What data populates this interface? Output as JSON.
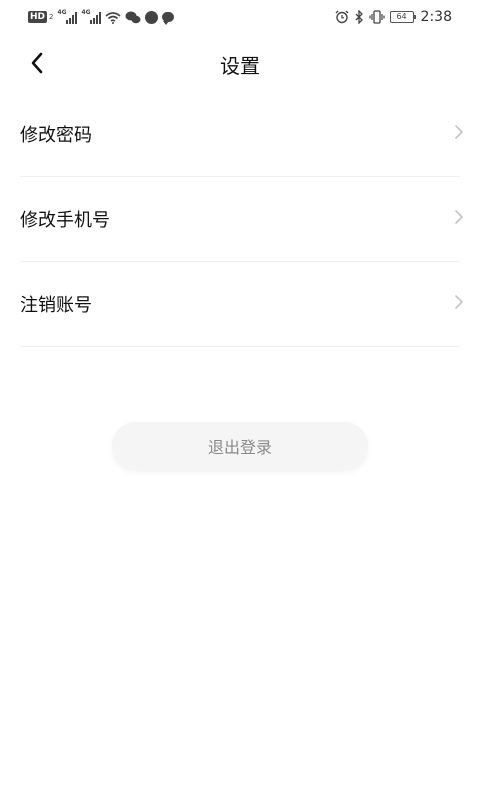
{
  "status_bar": {
    "hd_label": "HD",
    "hd_sub": "2",
    "signal_1_label": "4G",
    "signal_2_label": "4G",
    "battery_level": "64",
    "time": "2:38",
    "icons": [
      "wifi-icon",
      "wechat-icon",
      "app-icon",
      "message-icon",
      "alarm-icon",
      "bluetooth-icon",
      "vibrate-icon",
      "battery-icon"
    ]
  },
  "nav": {
    "title": "设置"
  },
  "settings": {
    "items": [
      {
        "label": "修改密码"
      },
      {
        "label": "修改手机号"
      },
      {
        "label": "注销账号"
      }
    ]
  },
  "logout": {
    "label": "退出登录"
  }
}
